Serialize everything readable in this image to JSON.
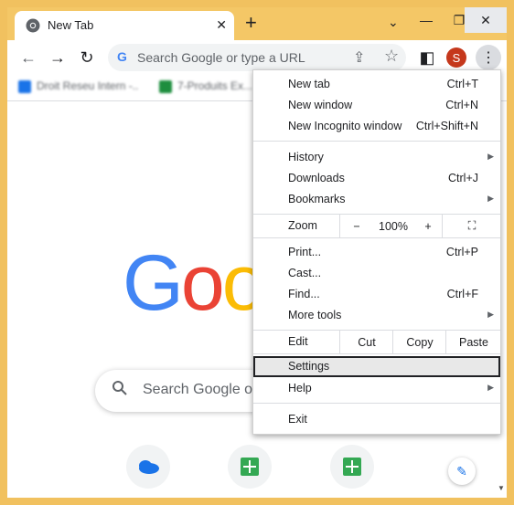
{
  "tab": {
    "title": "New Tab",
    "close": "✕",
    "new_tab": "+",
    "tab_search": "⌄"
  },
  "window_controls": {
    "minimize": "—",
    "maximize": "❐",
    "close": "✕"
  },
  "toolbar": {
    "back": "←",
    "forward": "→",
    "reload": "↻",
    "omnibox_placeholder": "Search Google or type a URL",
    "share": "⇪",
    "bookmark_star": "☆",
    "side_panel": "◧",
    "avatar_initial": "S",
    "menu_button": "⋮"
  },
  "bookmarks": [
    {
      "label": "Droit Reseu Intern -..",
      "icon_color": "#1a73e8"
    },
    {
      "label": "7-Produits Ex...",
      "icon_color": "#1e8e3e"
    }
  ],
  "page": {
    "logo_letters": [
      {
        "ch": "G",
        "color": "#4285f4"
      },
      {
        "ch": "o",
        "color": "#ea4335"
      },
      {
        "ch": "o",
        "color": "#fbbc05"
      }
    ],
    "search_placeholder": "Search Google or",
    "search_icon": "🔍",
    "pencil_icon": "✎"
  },
  "menu": {
    "new_tab": {
      "label": "New tab",
      "shortcut": "Ctrl+T"
    },
    "new_window": {
      "label": "New window",
      "shortcut": "Ctrl+N"
    },
    "incognito": {
      "label": "New Incognito window",
      "shortcut": "Ctrl+Shift+N"
    },
    "history": {
      "label": "History",
      "arrow": "▶"
    },
    "downloads": {
      "label": "Downloads",
      "shortcut": "Ctrl+J"
    },
    "bookmarks": {
      "label": "Bookmarks",
      "arrow": "▶"
    },
    "zoom": {
      "label": "Zoom",
      "minus": "−",
      "level": "100%",
      "plus": "+",
      "fullscreen": "⛶"
    },
    "print": {
      "label": "Print...",
      "shortcut": "Ctrl+P"
    },
    "cast": {
      "label": "Cast..."
    },
    "find": {
      "label": "Find...",
      "shortcut": "Ctrl+F"
    },
    "more_tools": {
      "label": "More tools",
      "arrow": "▶"
    },
    "edit": {
      "label": "Edit",
      "cut": "Cut",
      "copy": "Copy",
      "paste": "Paste"
    },
    "settings": {
      "label": "Settings"
    },
    "help": {
      "label": "Help",
      "arrow": "▶"
    },
    "exit": {
      "label": "Exit"
    }
  },
  "colors": {
    "frame": "#f4c766",
    "avatar": "#c5381c",
    "highlight_row": "#e8e8e8"
  }
}
